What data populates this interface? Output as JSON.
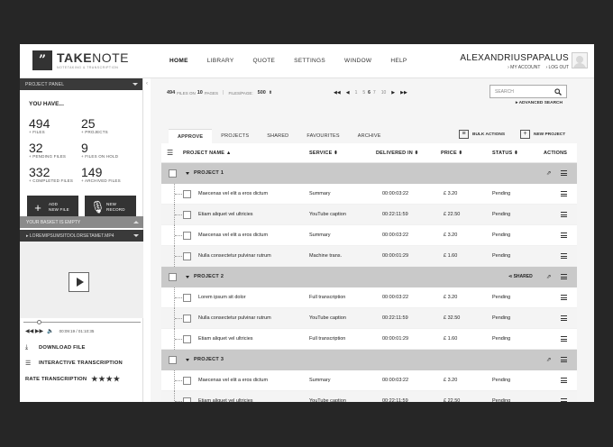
{
  "header": {
    "logo_mark": "”",
    "logo_take": "TAKE",
    "logo_note": "NOTE",
    "logo_sub": "NOTETAKING & TRANSCRIPTION",
    "nav": [
      "HOME",
      "LIBRARY",
      "QUOTE",
      "SETTINGS",
      "WINDOW",
      "HELP"
    ],
    "username": "ALEXANDRIUSPAPALUS",
    "my_account": "› MY ACCOUNT",
    "log_out": "› LOG OUT"
  },
  "sidebar": {
    "panel_title": "PROJECT PANEL",
    "you_have": "YOU HAVE...",
    "stats": [
      {
        "value": "494",
        "label": "FILES"
      },
      {
        "value": "25",
        "label": "PROJECTS"
      },
      {
        "value": "32",
        "label": "PENDING FILES"
      },
      {
        "value": "9",
        "label": "FILES ON HOLD"
      },
      {
        "value": "332",
        "label": "COMPLETED FILES"
      },
      {
        "value": "149",
        "label": "ARCHIVED FILES"
      }
    ],
    "add_new_file": [
      "ADD",
      "NEW FILE"
    ],
    "new_record": [
      "NEW",
      "RECORD"
    ],
    "basket": "YOUR BASKET IS EMPTY",
    "current_file": "LOREMIPSUMSITDOLORSETAMET.MP4",
    "time": "00:09:19 / 01:10:35",
    "progress_fraction": 0.13,
    "download": "DOWNLOAD FILE",
    "interactive": "INTERACTIVE TRANSCRIPTION",
    "rate": "RATE TRANSCRIPTION",
    "rating": 4,
    "stars": "★★★★"
  },
  "toolbar": {
    "files_count": "494",
    "files_on": "FILES ON",
    "pages_count": "10",
    "pages": "PAGES",
    "files_page_label": "FILES/PAGE:",
    "files_page_value": "500",
    "pages_nums": [
      "1",
      "5",
      "6",
      "7",
      "10"
    ],
    "search_placeholder": "SEARCH",
    "advanced_search": "ADVANCED SEARCH",
    "bulk_actions": "BULK ACTIONS",
    "new_project": "NEW PROJECT"
  },
  "tabs": [
    "APPROVE",
    "PROJECTS",
    "SHARED",
    "FAVOURITES",
    "ARCHIVE"
  ],
  "columns": [
    "PROJECT NAME",
    "SERVICE",
    "DELIVERED IN",
    "PRICE",
    "STATUS",
    "ACTIONS"
  ],
  "projects": [
    {
      "title": "PROJECT 1",
      "shared": "",
      "rows": [
        {
          "name": "Maecenas vel elit a eros dictum",
          "service": "Summary",
          "delivered": "00:00:03:22",
          "price": "£ 3.20",
          "status": "Pending"
        },
        {
          "name": "Etiam aliquet vel ultricies",
          "service": "YouTube caption",
          "delivered": "00:22:11:59",
          "price": "£ 22.50",
          "status": "Pending"
        },
        {
          "name": "Maecenas vel elit a eros dictum",
          "service": "Summary",
          "delivered": "00:00:03:22",
          "price": "£ 3.20",
          "status": "Pending"
        },
        {
          "name": "Nulla consectetur pulvinar rutrum",
          "service": "Machine trans.",
          "delivered": "00:00:01:29",
          "price": "£ 1.60",
          "status": "Pending"
        }
      ]
    },
    {
      "title": "PROJECT 2",
      "shared": "SHARED",
      "rows": [
        {
          "name": "Lorem ipsum sit dolor",
          "service": "Full transcription",
          "delivered": "00:00:03:22",
          "price": "£ 3.20",
          "status": "Pending"
        },
        {
          "name": "Nulla consectetur pulvinar rutrum",
          "service": "YouTube caption",
          "delivered": "00:22:11:59",
          "price": "£ 32.50",
          "status": "Pending"
        },
        {
          "name": "Etiam aliquet vel ultricies",
          "service": "Full transcription",
          "delivered": "00:00:01:29",
          "price": "£ 1.60",
          "status": "Pending"
        }
      ]
    },
    {
      "title": "PROJECT 3",
      "shared": "",
      "rows": [
        {
          "name": "Maecenas vel elit a eros dictum",
          "service": "Summary",
          "delivered": "00:00:03:22",
          "price": "£ 3.20",
          "status": "Pending"
        },
        {
          "name": "Etiam aliquet vel ultricies",
          "service": "YouTube caption",
          "delivered": "00:22:11:59",
          "price": "£ 22.50",
          "status": "Pending"
        }
      ]
    }
  ]
}
